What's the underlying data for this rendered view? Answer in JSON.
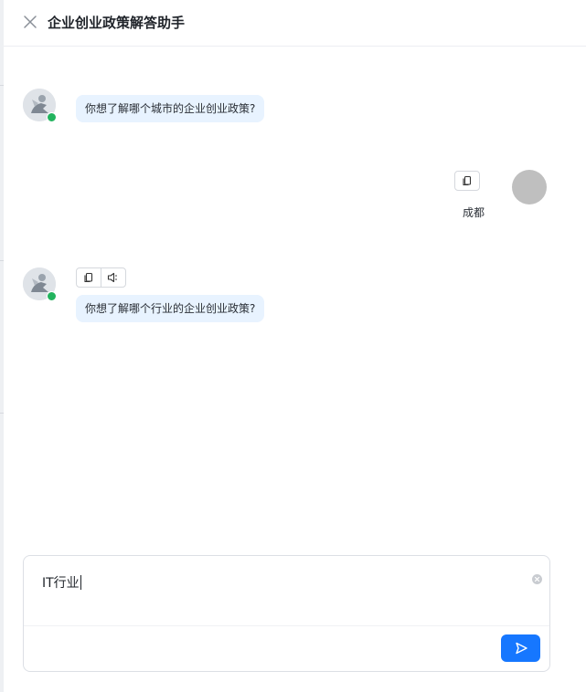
{
  "header": {
    "title": "企业创业政策解答助手"
  },
  "messages": [
    {
      "role": "assistant",
      "text": "你想了解哪个城市的企业创业政策?"
    },
    {
      "role": "user",
      "text": "成都"
    },
    {
      "role": "assistant",
      "text": "你想了解哪个行业的企业创业政策?"
    }
  ],
  "input": {
    "value": "IT行业"
  },
  "icons": {
    "close": "close-icon",
    "copy": "copy-icon",
    "speaker": "speaker-icon",
    "clear": "clear-icon",
    "send": "send-icon",
    "online": "online-status-dot"
  },
  "colors": {
    "bot_bubble": "#e8f3ff",
    "send_button": "#1677ff",
    "online": "#22b35e",
    "user_avatar": "#bfbfbf"
  }
}
